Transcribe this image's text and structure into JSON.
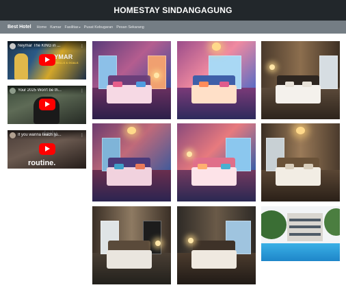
{
  "header": {
    "title": "HOMESTAY SINDANGAGUNG"
  },
  "navbar": {
    "brand": "Best Hotel",
    "items": [
      "Home",
      "Kamar",
      "Fasilitas",
      "Pusat Kebugaran",
      "Pesan Sekarang"
    ],
    "dropdown_item": "Fasilitas"
  },
  "videos": [
    {
      "title": "Neymar The KING in ...",
      "overlay_text": "EYMAR",
      "overlay_sub": "SKILLS & GOALS"
    },
    {
      "title": "Your 2025 Won't be th..."
    },
    {
      "title": "If you wanna reach su...",
      "overlay_top": "daily",
      "overlay_bottom": "routine."
    }
  ],
  "gallery": [
    {
      "alt": "hotel-room-photo",
      "kind": "room"
    },
    {
      "alt": "hotel-room-photo",
      "kind": "room"
    },
    {
      "alt": "hotel-room-photo",
      "kind": "room"
    },
    {
      "alt": "hotel-room-photo",
      "kind": "room"
    },
    {
      "alt": "hotel-room-photo",
      "kind": "room"
    },
    {
      "alt": "hotel-room-photo",
      "kind": "room"
    },
    {
      "alt": "hotel-room-photo",
      "kind": "room"
    },
    {
      "alt": "hotel-room-photo",
      "kind": "room"
    },
    {
      "alt": "hotel-exterior-pool-photo",
      "kind": "exterior"
    }
  ],
  "colors": {
    "header_bg": "#22272b",
    "navbar_bg": "#747d84",
    "youtube_red": "#ff0000"
  }
}
